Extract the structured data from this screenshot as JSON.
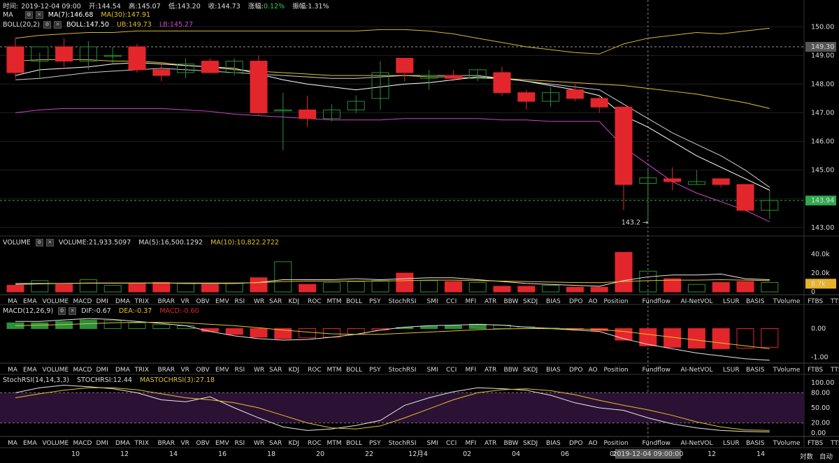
{
  "header": {
    "time_label": "时间:",
    "time_value": "2019-12-04 09:00",
    "open_label": "开:",
    "open_value": "144.54",
    "high_label": "高:",
    "high_value": "145.07",
    "low_label": "低:",
    "low_value": "143.20",
    "close_label": "收:",
    "close_value": "144.73",
    "change_label": "涨幅:",
    "change_value": "0.12%",
    "amp_label": "振幅:",
    "amp_value": "1.31%"
  },
  "main_legend": {
    "ma_name": "MA",
    "ma7": "MA(7):146.68",
    "ma30": "MA(30):147.91",
    "boll_name": "BOLL(20,2)",
    "boll_mid": "BOLL:147.50",
    "boll_ub": "UB:149.73",
    "boll_lb": "LB:145.27"
  },
  "volume_legend": {
    "name": "VOLUME",
    "value": "VOLUME:21,933.5097",
    "ma5": "MA(5):16,500.1292",
    "ma10": "MA(10):10,822.2722"
  },
  "macd_legend": {
    "name": "MACD(12,26,9)",
    "dif": "DIF:-0.67",
    "dea": "DEA:-0.37",
    "macd": "MACD:-0.60"
  },
  "stoch_legend": {
    "name": "StochRSI(14,14,3,3)",
    "k": "STOCHRSI:12.44",
    "d": "MASTOCHRSI(3):27.18"
  },
  "colors": {
    "up": "#2a8f3a",
    "down": "#e3262c",
    "ma7": "#ffffff",
    "ma30": "#e6c229",
    "boll_ub": "#d8b83a",
    "boll_lb": "#d045c8",
    "macd_dea": "#e6c229",
    "stoch_band": "#2b1134"
  },
  "price_axis": {
    "ticks": [
      "150.00",
      "149.00",
      "148.00",
      "147.00",
      "146.00",
      "145.00",
      "144.00",
      "143.00"
    ],
    "tag_high": "149.30",
    "tag_last": "143.94",
    "low_marker": "143.2"
  },
  "volume_axis": {
    "ticks": [
      "40.0k",
      "20.0k",
      "0"
    ],
    "tag_last": "8.7k"
  },
  "macd_axis": {
    "ticks": [
      "0.00",
      "-1.00"
    ]
  },
  "stoch_axis": {
    "ticks": [
      "100.00",
      "80.00",
      "50.00",
      "20.00",
      "0.00"
    ]
  },
  "indicator_tabs": [
    "MA",
    "EMA",
    "VOLUME",
    "MACD",
    "DMI",
    "DMA",
    "TRIX",
    "BRAR",
    "VR",
    "OBV",
    "EMV",
    "RSI",
    "WR",
    "SAR",
    "KDJ",
    "ROC",
    "MTM",
    "BOLL",
    "PSY",
    "StochRSI",
    "SMI",
    "CCI",
    "MFI",
    "ATR",
    "BBW",
    "SKDJ",
    "BIAS",
    "DPO",
    "AO",
    "Position",
    "Fundflow",
    "AI-NetVOL",
    "LSUR",
    "BASIS",
    "TVolume",
    "FTBS",
    "TTSI",
    "TTMU"
  ],
  "tab_rows": [
    {
      "active": "VOLUME",
      "dim": [
        "StochRSI"
      ]
    },
    {
      "active": "MACD",
      "dim": [
        "VOLUME",
        "StochRSI"
      ]
    },
    {
      "active": "StochRSI",
      "dim": [
        "VOLUME",
        "MACD"
      ]
    }
  ],
  "time_axis": {
    "labels": [
      "10",
      "12",
      "14",
      "16",
      "18",
      "20",
      "22",
      "12月4",
      "02",
      "04",
      "06",
      "08",
      "10",
      "12",
      "14"
    ],
    "cursor_label": "2019-12-04 09:00:00"
  },
  "bottom_buttons": {
    "log": "対数",
    "auto": "自动"
  },
  "chart_data": {
    "type": "candlestick",
    "candles": [
      {
        "o": 149.3,
        "h": 149.6,
        "l": 148.2,
        "c": 148.4
      },
      {
        "o": 148.8,
        "h": 149.1,
        "l": 148.2,
        "c": 149.3
      },
      {
        "o": 149.3,
        "h": 149.6,
        "l": 148.6,
        "c": 148.8
      },
      {
        "o": 148.8,
        "h": 149.5,
        "l": 148.5,
        "c": 149.3
      },
      {
        "o": 149.0,
        "h": 149.3,
        "l": 148.7,
        "c": 149.0
      },
      {
        "o": 149.3,
        "h": 149.4,
        "l": 148.4,
        "c": 148.5
      },
      {
        "o": 148.5,
        "h": 148.7,
        "l": 148.1,
        "c": 148.3
      },
      {
        "o": 148.4,
        "h": 148.9,
        "l": 148.2,
        "c": 148.7
      },
      {
        "o": 148.8,
        "h": 148.9,
        "l": 148.4,
        "c": 148.4
      },
      {
        "o": 148.4,
        "h": 148.9,
        "l": 148.3,
        "c": 148.8
      },
      {
        "o": 148.8,
        "h": 149.0,
        "l": 146.9,
        "c": 147.0
      },
      {
        "o": 147.1,
        "h": 147.7,
        "l": 145.7,
        "c": 147.1
      },
      {
        "o": 147.1,
        "h": 147.6,
        "l": 146.5,
        "c": 146.8
      },
      {
        "o": 146.8,
        "h": 147.3,
        "l": 146.7,
        "c": 147.1
      },
      {
        "o": 147.1,
        "h": 147.6,
        "l": 147.0,
        "c": 147.4
      },
      {
        "o": 147.5,
        "h": 148.8,
        "l": 147.1,
        "c": 148.4
      },
      {
        "o": 148.9,
        "h": 148.8,
        "l": 148.1,
        "c": 148.4
      },
      {
        "o": 148.2,
        "h": 148.5,
        "l": 147.8,
        "c": 148.3
      },
      {
        "o": 148.3,
        "h": 148.5,
        "l": 148.1,
        "c": 148.2
      },
      {
        "o": 148.2,
        "h": 148.5,
        "l": 148.1,
        "c": 148.5
      },
      {
        "o": 148.4,
        "h": 148.6,
        "l": 147.6,
        "c": 147.7
      },
      {
        "o": 147.7,
        "h": 147.8,
        "l": 147.1,
        "c": 147.4
      },
      {
        "o": 147.4,
        "h": 147.9,
        "l": 147.2,
        "c": 147.7
      },
      {
        "o": 147.8,
        "h": 148.0,
        "l": 147.4,
        "c": 147.5
      },
      {
        "o": 147.5,
        "h": 147.6,
        "l": 147.0,
        "c": 147.2
      },
      {
        "o": 147.2,
        "h": 147.2,
        "l": 143.6,
        "c": 144.5
      },
      {
        "o": 144.54,
        "h": 145.07,
        "l": 143.2,
        "c": 144.73
      },
      {
        "o": 144.7,
        "h": 145.1,
        "l": 144.3,
        "c": 144.6
      },
      {
        "o": 144.5,
        "h": 145.0,
        "l": 144.5,
        "c": 144.6
      },
      {
        "o": 144.7,
        "h": 144.7,
        "l": 144.4,
        "c": 144.5
      },
      {
        "o": 144.5,
        "h": 144.5,
        "l": 143.6,
        "c": 143.6
      },
      {
        "o": 143.6,
        "h": 144.3,
        "l": 143.3,
        "c": 143.94
      }
    ],
    "ma7": [
      148.3,
      148.5,
      148.55,
      148.6,
      148.7,
      148.75,
      148.7,
      148.65,
      148.6,
      148.55,
      148.35,
      148.15,
      148.0,
      147.9,
      147.8,
      147.9,
      148.0,
      148.05,
      148.15,
      148.25,
      148.2,
      148.1,
      147.95,
      147.8,
      147.6,
      146.9,
      146.5,
      146.0,
      145.5,
      145.1,
      144.7,
      144.3
    ],
    "ma30": [
      148.8,
      148.85,
      148.85,
      148.85,
      148.8,
      148.8,
      148.75,
      148.65,
      148.6,
      148.5,
      148.45,
      148.4,
      148.35,
      148.3,
      148.3,
      148.3,
      148.3,
      148.25,
      148.25,
      148.2,
      148.2,
      148.15,
      148.1,
      148.05,
      148.0,
      147.95,
      147.85,
      147.75,
      147.65,
      147.5,
      147.35,
      147.15
    ],
    "boll_ub": [
      149.6,
      149.7,
      149.75,
      149.8,
      149.8,
      149.85,
      149.85,
      149.85,
      149.85,
      149.85,
      149.85,
      149.85,
      149.85,
      149.85,
      149.85,
      149.9,
      149.9,
      149.85,
      149.75,
      149.6,
      149.45,
      149.3,
      149.2,
      149.1,
      149.05,
      149.4,
      149.6,
      149.7,
      149.8,
      149.75,
      149.85,
      149.95
    ],
    "boll_mid": [
      148.15,
      148.2,
      148.3,
      148.4,
      148.45,
      148.5,
      148.55,
      148.5,
      148.45,
      148.4,
      148.35,
      148.3,
      148.25,
      148.2,
      148.2,
      148.25,
      148.3,
      148.3,
      148.3,
      148.3,
      148.2,
      148.1,
      148.0,
      147.9,
      147.8,
      147.3,
      146.8,
      146.3,
      145.9,
      145.5,
      145.0,
      144.4
    ],
    "boll_lb": [
      147.0,
      147.1,
      147.15,
      147.15,
      147.15,
      147.15,
      147.15,
      147.1,
      147.05,
      146.95,
      146.9,
      146.85,
      146.8,
      146.75,
      146.75,
      146.75,
      146.8,
      146.8,
      146.8,
      146.8,
      146.75,
      146.75,
      146.7,
      146.7,
      146.7,
      145.8,
      145.2,
      144.6,
      144.2,
      143.9,
      143.6,
      143.2
    ],
    "volume": [
      5,
      9,
      6,
      10,
      5,
      6,
      7,
      7,
      5,
      6,
      12,
      27,
      6,
      7,
      8,
      8,
      17,
      9,
      8,
      6,
      4,
      4,
      4,
      3,
      3,
      3,
      4,
      3,
      3,
      2,
      3,
      3,
      3,
      3,
      3,
      3,
      3,
      3,
      3,
      3,
      3,
      3,
      3,
      3,
      3,
      3,
      3,
      3,
      3,
      3,
      3,
      3,
      3,
      3,
      3,
      3,
      3,
      3,
      3,
      3,
      3,
      3,
      3,
      3,
      3,
      3,
      3,
      3,
      3,
      3,
      3,
      3,
      3,
      3,
      3,
      3,
      3,
      3,
      3,
      3,
      3,
      3,
      3,
      3,
      3,
      3,
      3,
      3,
      3,
      3,
      3,
      3,
      3,
      3,
      3,
      3,
      3,
      3,
      3,
      3,
      3,
      3,
      3,
      3,
      3,
      3,
      3,
      3,
      3,
      3,
      3,
      3,
      3,
      3,
      3,
      3,
      3,
      3,
      3,
      3,
      3,
      3,
      3,
      3,
      3,
      3,
      3,
      3,
      3,
      3,
      3,
      3,
      3,
      3,
      3,
      3,
      3,
      3,
      3,
      3,
      3,
      3,
      3,
      3,
      3,
      3,
      3,
      3,
      3,
      3,
      3,
      3,
      3,
      3,
      3,
      3,
      3,
      3,
      3,
      3,
      3,
      3,
      3,
      3,
      3,
      3,
      3,
      3,
      3,
      3,
      3,
      3,
      3,
      3,
      3,
      3,
      3,
      3,
      3,
      3,
      3,
      3,
      3,
      3,
      3,
      3,
      3,
      3,
      3,
      3,
      3,
      3,
      3,
      3,
      3,
      3,
      3,
      3,
      3,
      3,
      3,
      3,
      3,
      3,
      3,
      3,
      3,
      3,
      3,
      3,
      3,
      3,
      3,
      3,
      3,
      3,
      3,
      3,
      3,
      3,
      3,
      3,
      3,
      3,
      3,
      3,
      3,
      3,
      3,
      3,
      3,
      3,
      3,
      3,
      3,
      3,
      3,
      3,
      3,
      3,
      3,
      3,
      3,
      3,
      3,
      3,
      3,
      3,
      3,
      3,
      3,
      3,
      3,
      3,
      3,
      3,
      3,
      3,
      3,
      3,
      3,
      3,
      3,
      3,
      3,
      3,
      3,
      3,
      3,
      3,
      3
    ],
    "volumes_k": [
      7,
      12,
      8,
      13,
      7,
      9,
      10,
      9,
      8,
      9,
      15,
      32,
      8,
      10,
      11,
      12,
      20,
      12,
      11,
      10,
      6,
      6,
      7,
      5,
      5,
      42,
      22,
      14,
      8,
      10,
      11,
      10
    ],
    "volume_ma5": [
      8,
      8.5,
      9,
      9.5,
      9.5,
      9.5,
      9.5,
      9,
      9,
      9,
      10,
      13,
      13,
      13,
      14,
      13,
      14,
      15,
      15,
      13,
      11,
      9,
      8,
      7,
      6,
      12,
      16,
      18,
      18,
      19,
      14,
      13
    ],
    "volume_ma10": [
      9,
      9,
      9,
      9.2,
      9.2,
      9.3,
      9.4,
      9.5,
      9.5,
      9.5,
      9.8,
      11,
      11.5,
      11.5,
      11.5,
      11.5,
      12,
      12.5,
      12.5,
      12,
      11.5,
      11,
      10.5,
      10,
      9.8,
      11,
      12,
      12.5,
      12.5,
      13,
      12.5,
      12
    ],
    "macd_hist": [
      0.2,
      0.2,
      0.25,
      0.3,
      0.28,
      0.2,
      0.14,
      0.1,
      -0.1,
      -0.2,
      -0.3,
      -0.35,
      -0.32,
      -0.3,
      -0.2,
      -0.05,
      0.04,
      0.08,
      0.1,
      0.15,
      0.12,
      0.06,
      0.02,
      -0.02,
      -0.07,
      -0.4,
      -0.6,
      -0.65,
      -0.68,
      -0.7,
      -0.68,
      -0.65
    ],
    "macd_dif": [
      0.25,
      0.25,
      0.3,
      0.35,
      0.32,
      0.25,
      0.18,
      0.1,
      -0.1,
      -0.25,
      -0.35,
      -0.4,
      -0.38,
      -0.3,
      -0.2,
      -0.05,
      0.05,
      0.1,
      0.12,
      0.15,
      0.12,
      0.05,
      0.0,
      -0.05,
      -0.1,
      -0.35,
      -0.55,
      -0.7,
      -0.85,
      -0.95,
      -1.05,
      -1.1
    ],
    "macd_dea": [
      0.1,
      0.12,
      0.14,
      0.17,
      0.2,
      0.22,
      0.22,
      0.2,
      0.15,
      0.1,
      0.03,
      -0.05,
      -0.12,
      -0.18,
      -0.2,
      -0.2,
      -0.16,
      -0.12,
      -0.08,
      -0.04,
      -0.01,
      0.0,
      0.0,
      -0.01,
      -0.03,
      -0.1,
      -0.2,
      -0.3,
      -0.4,
      -0.5,
      -0.6,
      -0.7
    ],
    "stoch_k": [
      80,
      90,
      95,
      92,
      88,
      80,
      66,
      62,
      72,
      50,
      30,
      12,
      5,
      8,
      15,
      25,
      55,
      70,
      82,
      90,
      88,
      85,
      75,
      60,
      50,
      45,
      30,
      18,
      10,
      5,
      3,
      2
    ],
    "stoch_d": [
      70,
      78,
      85,
      90,
      90,
      86,
      78,
      70,
      66,
      60,
      50,
      35,
      20,
      10,
      8,
      14,
      30,
      48,
      66,
      80,
      86,
      88,
      84,
      76,
      65,
      55,
      46,
      35,
      22,
      12,
      6,
      5
    ]
  }
}
